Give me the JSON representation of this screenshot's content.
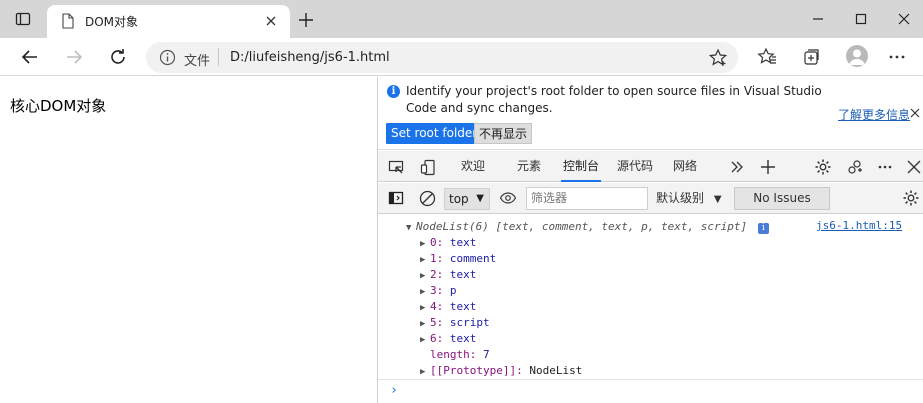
{
  "browser": {
    "tab_title": "DOM对象",
    "url_scheme": "文件",
    "url": "D:/liufeisheng/js6-1.html"
  },
  "page": {
    "heading": "核心DOM对象"
  },
  "devtools": {
    "info_message": "Identify your project's root folder to open source files in Visual Studio Code and sync changes.",
    "learn_more": "了解更多信息",
    "set_root_button": "Set root folder",
    "dont_show_button": "不再显示",
    "tabs": [
      {
        "label": "欢迎"
      },
      {
        "label": "元素"
      },
      {
        "label": "控制台"
      },
      {
        "label": "源代码"
      },
      {
        "label": "网络"
      }
    ],
    "active_tab": "控制台",
    "console_toolbar": {
      "context": "top",
      "filter_placeholder": "筛选器",
      "level": "默认级别",
      "issues": "No Issues"
    },
    "console": {
      "summary": "NodeList(6) [text, comment, text, p, text, script]",
      "source": "js6-1.html:15",
      "items": [
        {
          "key": "0",
          "value": "text"
        },
        {
          "key": "1",
          "value": "comment"
        },
        {
          "key": "2",
          "value": "text"
        },
        {
          "key": "3",
          "value": "p"
        },
        {
          "key": "4",
          "value": "text"
        },
        {
          "key": "5",
          "value": "script"
        },
        {
          "key": "6",
          "value": "text"
        }
      ],
      "length_key": "length",
      "length_value": "7",
      "proto_key": "[[Prototype]]",
      "proto_value": "NodeList",
      "prompt": "›"
    }
  }
}
